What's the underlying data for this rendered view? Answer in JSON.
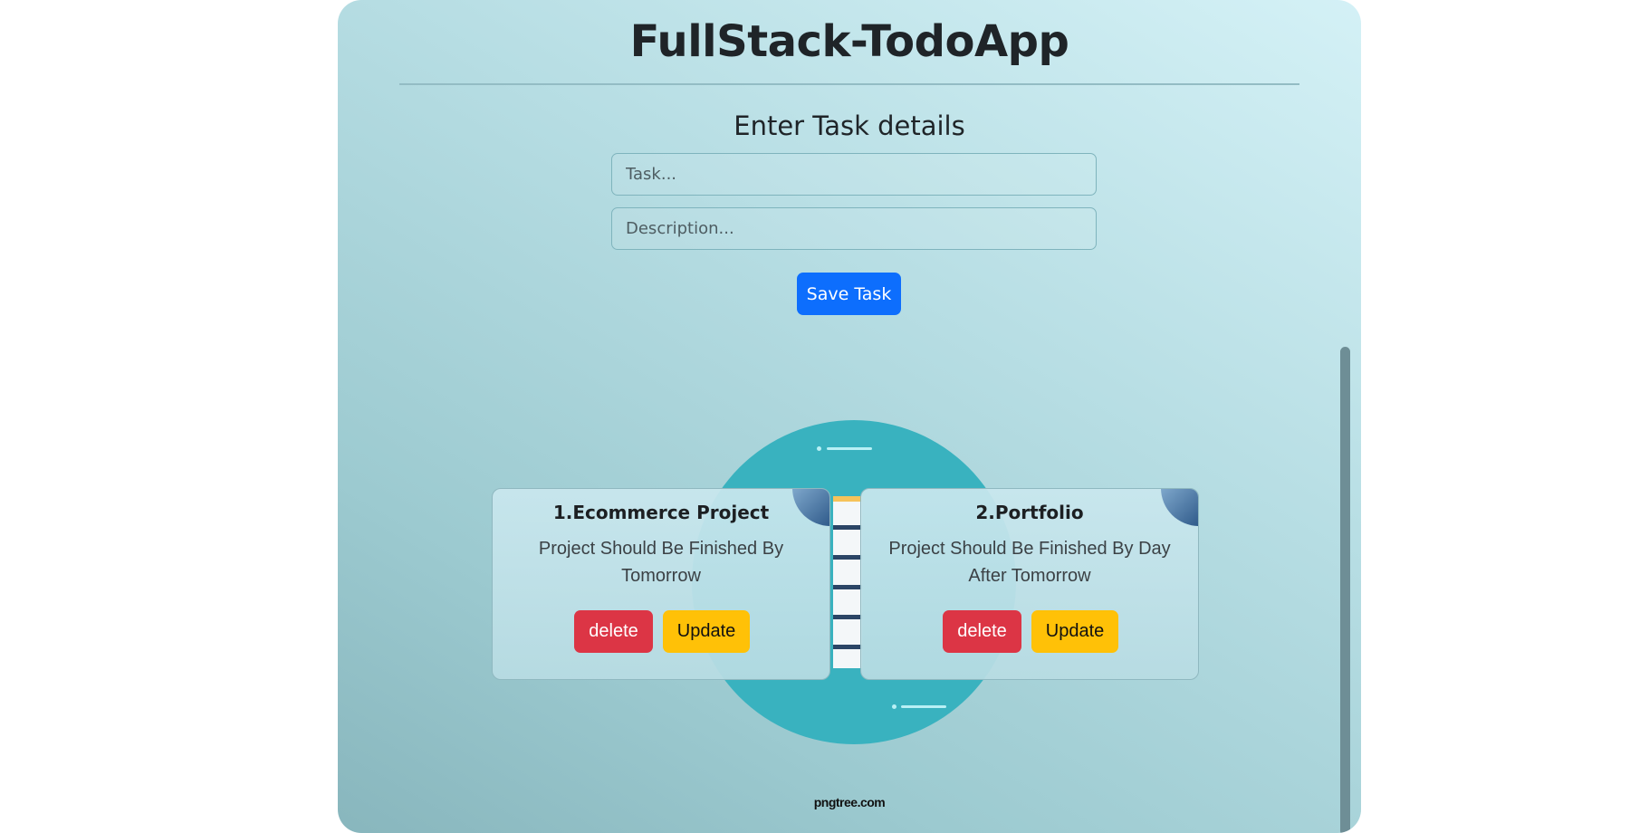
{
  "app": {
    "title": "FullStack-TodoApp",
    "form_heading": "Enter Task details",
    "task_placeholder": "Task...",
    "description_placeholder": "Description...",
    "save_label": "Save Task"
  },
  "background": {
    "watermark": "pngtree.com"
  },
  "tasks": [
    {
      "title": "1.Ecommerce Project",
      "description": "Project Should Be Finished By Tomorrow",
      "delete_label": "delete",
      "update_label": "Update"
    },
    {
      "title": "2.Portfolio",
      "description": "Project Should Be Finished By Day After Tomorrow",
      "delete_label": "delete",
      "update_label": "Update"
    }
  ],
  "colors": {
    "primary": "#0d6efd",
    "danger": "#dc3545",
    "warning": "#ffc107",
    "illustration_circle": "#39b2bf"
  }
}
